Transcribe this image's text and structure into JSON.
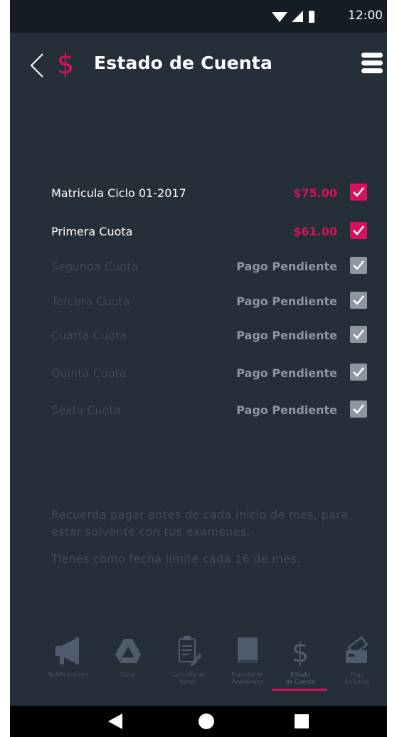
{
  "status_bar": {
    "time": "12:00"
  },
  "header": {
    "title": "Estado de Cuenta"
  },
  "payments": [
    {
      "label": "Matricula Ciclo 01-2017",
      "value": "$75.00",
      "status": "paid"
    },
    {
      "label": "Primera Cuota",
      "value": "$61.00",
      "status": "paid"
    },
    {
      "label": "Segunda Cuota",
      "value": "Pago Pendiente",
      "status": "pending"
    },
    {
      "label": "Tercera Cuota",
      "value": "Pago Pendiente",
      "status": "pending"
    },
    {
      "label": "Cuarta Cuota",
      "value": "Pago Pendiente",
      "status": "pending"
    },
    {
      "label": "Quinta Cuota",
      "value": "Pago Pendiente",
      "status": "pending"
    },
    {
      "label": "Sexta Cuota",
      "value": "Pago Pendiente",
      "status": "pending"
    }
  ],
  "notice": {
    "reminder": "Recuerda pagar antes de cada inicio de mes, para estar solvente con tus examenes.",
    "deadline": "Tienes como fecha limite cada 16 de mes."
  },
  "bottom_nav": [
    {
      "label": "Notificaciones",
      "icon": "megaphone-icon"
    },
    {
      "label": "Drive",
      "icon": "drive-icon"
    },
    {
      "label": "Consulta de\nNotas",
      "icon": "clipboard-icon"
    },
    {
      "label": "Expediente\nAcadémico",
      "icon": "book-icon"
    },
    {
      "label": "Estado\nde Cuenta",
      "icon": "dollar-icon",
      "active": true
    },
    {
      "label": "Pago\nEn Linea",
      "icon": "credit-card-icon"
    }
  ],
  "colors": {
    "accent": "#d8115e",
    "background": "#252f3a",
    "status_bar": "#151c26"
  }
}
